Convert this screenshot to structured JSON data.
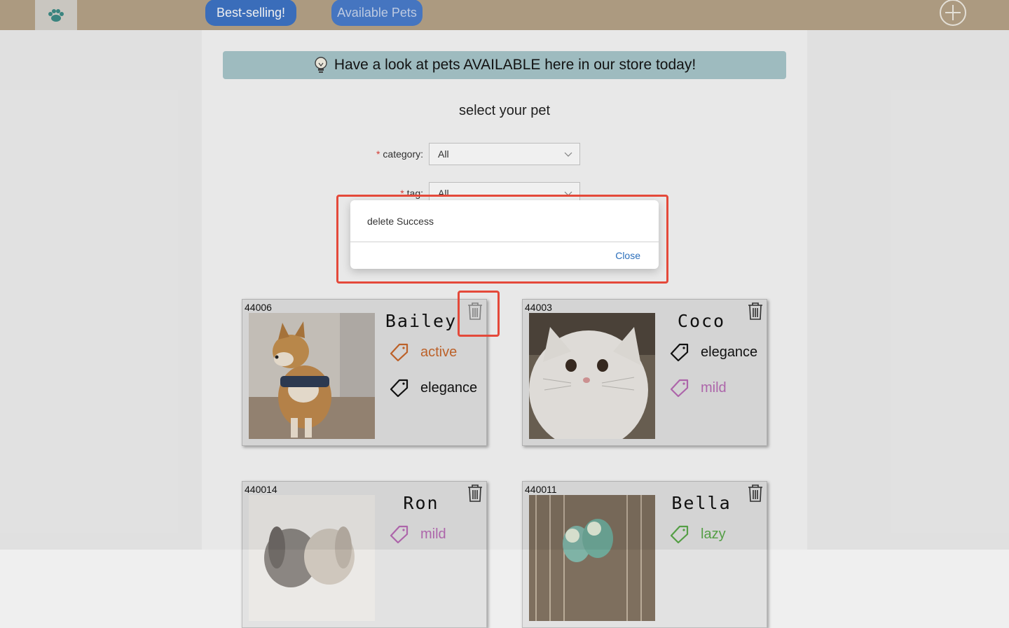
{
  "nav": {
    "best_selling": "Best-selling!",
    "available_pets": "Available Pets"
  },
  "banner": {
    "text": "Have a look at pets AVAILABLE here in our store today!"
  },
  "form": {
    "title": "select your pet",
    "category_label": "category:",
    "category_value": "All",
    "tag_label": "tag:",
    "tag_value": "All"
  },
  "dialog": {
    "message": "delete Success",
    "close_label": "Close"
  },
  "pets": [
    {
      "id": "44006",
      "name": "Bailey",
      "tags": [
        {
          "label": "active",
          "color": "#c8682c"
        },
        {
          "label": "elegance",
          "color": "#111111"
        }
      ]
    },
    {
      "id": "44003",
      "name": "Coco",
      "tags": [
        {
          "label": "elegance",
          "color": "#111111"
        },
        {
          "label": "mild",
          "color": "#b86cb5"
        }
      ]
    },
    {
      "id": "440014",
      "name": "Ron",
      "tags": [
        {
          "label": "mild",
          "color": "#b86cb5"
        }
      ]
    },
    {
      "id": "440011",
      "name": "Bella",
      "tags": [
        {
          "label": "lazy",
          "color": "#5aa84a"
        }
      ]
    }
  ],
  "colors": {
    "topbar": "#b7a488",
    "nav_button": "#3e74c6",
    "banner": "#a8c7cb",
    "highlight": "#e4493a"
  }
}
